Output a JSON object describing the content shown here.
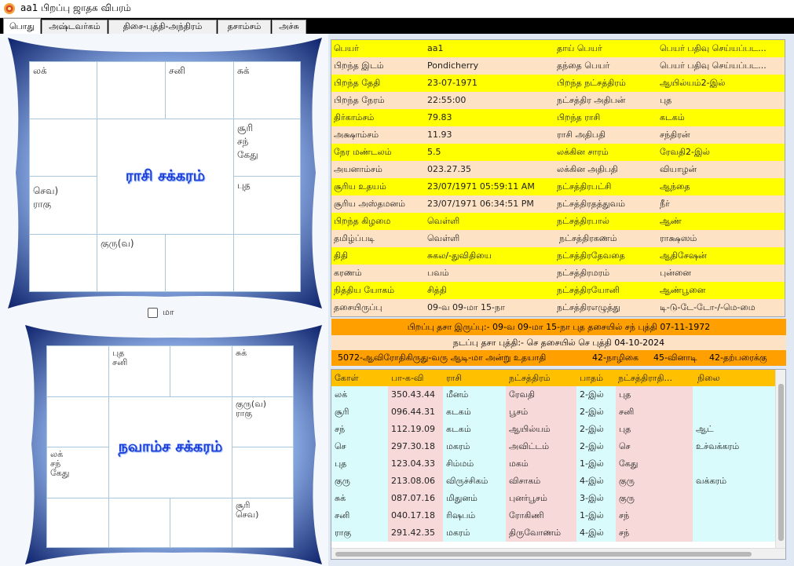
{
  "window": {
    "title": "aa1 பிறப்பு ஜாதக விபரம்"
  },
  "tabs": [
    "பொது",
    "அஷ்டவர்கம்",
    "திசை-புத்தி-அந்திரம்",
    "தசாம்சம்",
    "அச்சு"
  ],
  "rasi_chart": {
    "title": "ராசி சக்கரம்",
    "cells": {
      "top_0": "லக்",
      "top_1": "",
      "top_2": "சனி",
      "top_3": "சுக்",
      "right_0": "சூரி\nசந்\nகேது",
      "right_1": "புத",
      "left_0": "",
      "left_1": "செவ)\nராகு",
      "bottom_0": "",
      "bottom_1": "குரு(வ)",
      "bottom_2": "",
      "bottom_3": ""
    }
  },
  "ma_checkbox": {
    "label": "மா",
    "checked": false
  },
  "navamsa_chart": {
    "title": "நவாம்ச சக்கரம்",
    "cells": {
      "top_0": "",
      "top_1": "புத\nசனி",
      "top_2": "",
      "top_3": "சுக்",
      "right_0": "குரு(வ)\nராகு",
      "right_1": "",
      "left_0": "",
      "left_1": "லக்\nசந்\nகேது",
      "bottom_0": "",
      "bottom_1": "",
      "bottom_2": "",
      "bottom_3": "சூரி\nசெவ)"
    }
  },
  "info_rows": [
    [
      "பெயர்",
      "aa1",
      "தாய் பெயர்",
      "பெயர் பதிவு செய்யப்பட..."
    ],
    [
      "பிறந்த இடம்",
      "Pondicherry",
      "தந்தை பெயர்",
      "பெயர் பதிவு செய்யப்பட..."
    ],
    [
      "பிறந்த தேதி",
      "23-07-1971",
      "பிறந்த நட்சத்திரம்",
      "ஆயில்யம்2-இல்"
    ],
    [
      "பிறந்த நேரம்",
      "22:55:00",
      "நட்சத்திர அதிபன்",
      "புத"
    ],
    [
      "திர்காம்சம்",
      "79.83",
      "பிறந்த ராசி",
      "கடகம்"
    ],
    [
      "அக்ஷாம்சம்",
      "11.93",
      "ராசி அதிபதி",
      "சந்திரன்"
    ],
    [
      "நேர மண்டலம்",
      "5.5",
      "லக்கின சாரம்",
      "ரேவதி2-இல்"
    ],
    [
      "அயனாம்சம்",
      "023.27.35",
      "லக்கின அதிபதி",
      "வியாழன்"
    ],
    [
      "சூரிய உதயம்",
      "23/07/1971 05:59:11 AM",
      "நட்சத்திரபட்சி",
      "ஆந்தை"
    ],
    [
      "சூரிய அஸ்தமனம்",
      "23/07/1971 06:34:51 PM",
      "நட்சத்திரதத்துவம்",
      "நீர்"
    ],
    [
      "பிறந்த கிழமை",
      "வெள்ளி",
      "நட்சத்திரபால்",
      "ஆண்"
    ],
    [
      "தமிழ்ப்படி",
      "வெள்ளி",
      "நட்சத்திரகணம்",
      "ராக்ஷஸம்"
    ],
    [
      "திதி",
      "சுகல/-துவிதியை",
      "நட்சத்திரதேவதை",
      "ஆதிசேஷன்"
    ],
    [
      "கரணம்",
      "பவம்",
      "நட்சத்திரமரம்",
      "புன்னை"
    ],
    [
      "நித்திய யோகம்",
      "சித்தி",
      "நட்சத்திரயோனி",
      "ஆண்பூனை"
    ],
    [
      "தசையிருப்பு",
      "09-வ 09-மா 15-நா",
      "நட்சத்திரஎழுத்து",
      "டி-டு-டே-டோ-/-மெ-மை"
    ]
  ],
  "dasa": {
    "birth": "பிறப்பு தசா இருப்பு:- 09-வ 09-மா 15-நா  புத தசையில் சந் புத்தி 07-11-1972",
    "current": "நடப்பு தசா புத்தி:- செ தசையில் செ புத்தி 04-10-2024",
    "line3_a": "5072-ஆவிரோதிகிருது-வரு ஆடி-மா அன்று உதயாதி",
    "line3_b": "42-நாழிகை",
    "line3_c": "45-வினாடி",
    "line3_d": "42-தற்பரைக்கு"
  },
  "planet_table": {
    "headers": [
      "கோள்",
      "பா-க-வி",
      "ராசி",
      "நட்சத்திரம்",
      "பாதம்",
      "நட்சத்திராதி...",
      "நிலை"
    ],
    "rows": [
      [
        "லக்",
        "350.43.44",
        "மீனம்",
        "ரேவதி",
        "2-இல்",
        "புத",
        ""
      ],
      [
        "சூரி",
        "096.44.31",
        "கடகம்",
        "பூசம்",
        "2-இல்",
        "சனி",
        ""
      ],
      [
        "சந்",
        "112.19.09",
        "கடகம்",
        "ஆயில்யம்",
        "2-இல்",
        "புத",
        "ஆட்"
      ],
      [
        "செ",
        "297.30.18",
        "மகரம்",
        "அவிட்டம்",
        "2-இல்",
        "செ",
        "உச்வக்கரம்"
      ],
      [
        "புத",
        "123.04.33",
        "சிம்மம்",
        "மகம்",
        "1-இல்",
        "கேது",
        ""
      ],
      [
        "குரு",
        "213.08.06",
        "விருச்சிகம்",
        "விசாகம்",
        "4-இல்",
        "குரு",
        "வக்கரம்"
      ],
      [
        "சுக்",
        "087.07.16",
        "மிதுனம்",
        "புனர்பூசம்",
        "3-இல்",
        "குரு",
        ""
      ],
      [
        "சனி",
        "040.17.18",
        "ரிஷபம்",
        "ரோகிணி",
        "1-இல்",
        "சந்",
        ""
      ],
      [
        "ராகு",
        "291.42.35",
        "மகரம்",
        "திருவோணம்",
        "4-இல்",
        "சந்",
        ""
      ]
    ]
  }
}
